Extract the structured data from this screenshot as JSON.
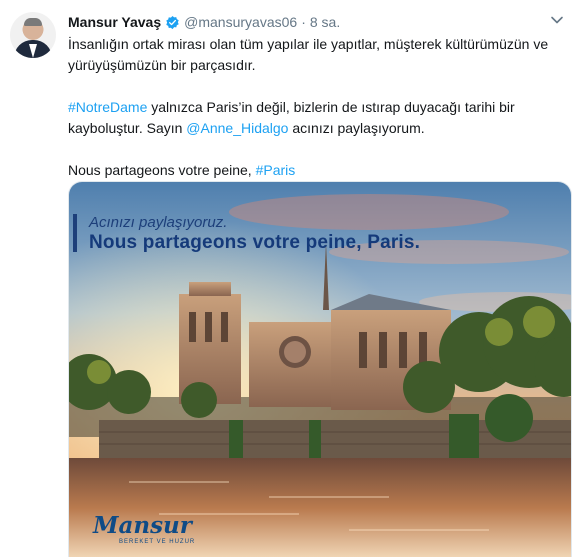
{
  "tweet": {
    "author_name": "Mansur Yavaş",
    "handle": "@mansuryavas06",
    "separator": "·",
    "time": "8 sa.",
    "verified_icon": "verified-badge-icon",
    "menu_icon": "chevron-down-icon",
    "line1": "İnsanlığın ortak mirası olan tüm yapılar ile yapıtlar, müşterek kültürümüzün ve",
    "line2": "yürüyüşümüzün bir parçasıdır.",
    "hashtag_notre_dame": "#NotreDame",
    "line3_rest": " yalnızca Paris’in değil, bizlerin de ıstırap duyacağı tarihi bir",
    "line4_start": "kayboluştur. Sayın ",
    "mention": "@Anne_Hidalgo",
    "line4_end": " acınızı paylaşıyorum.",
    "line5_start": "Nous partageons votre peine, ",
    "hashtag_paris": "#Paris"
  },
  "media": {
    "kicker": "Acınızı paylaşıyoruz.",
    "headline": "Nous partageons votre peine, Paris.",
    "brand": "Mansur",
    "brand_sub": "BEREKET VE HUZUR"
  },
  "colors": {
    "link": "#1da1f2",
    "verified": "#1da1f2",
    "secondary_text": "#657786",
    "headline": "#153a7a"
  }
}
